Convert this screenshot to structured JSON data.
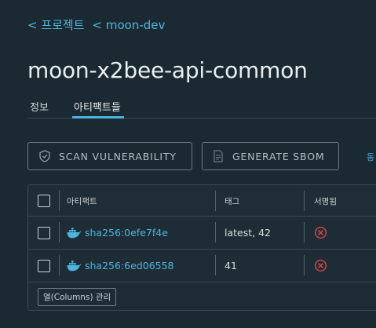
{
  "breadcrumb": {
    "items": [
      "< 프로젝트",
      "< moon-dev"
    ]
  },
  "page_title": "moon-x2bee-api-common",
  "tabs": [
    {
      "label": "정보",
      "active": false
    },
    {
      "label": "아티팩트들",
      "active": true
    }
  ],
  "toolbar": {
    "scan_label": "SCAN VULNERABILITY",
    "sbom_label": "GENERATE SBOM",
    "overflow_text": "동"
  },
  "table": {
    "columns": [
      "아티팩트",
      "태그",
      "서명됨"
    ],
    "rows": [
      {
        "artifact": "sha256:0efe7f4e",
        "tags": "latest, 42",
        "signed": false
      },
      {
        "artifact": "sha256:6ed06558",
        "tags": "41",
        "signed": false
      }
    ],
    "columns_button": "열(Columns) 관리"
  },
  "colors": {
    "background": "#1b2a32",
    "accent": "#4fb3e0",
    "error": "#e0454a"
  },
  "icons": {
    "scan": "shield-check-icon",
    "sbom": "document-icon",
    "artifact": "docker-whale-icon",
    "not_signed": "x-circle-icon"
  }
}
